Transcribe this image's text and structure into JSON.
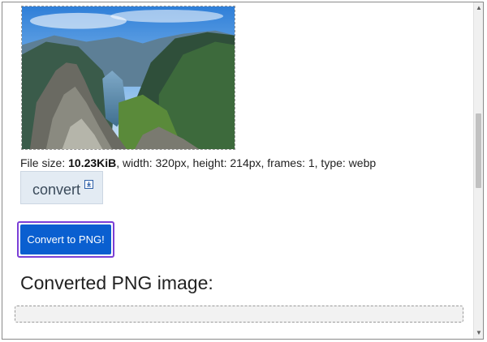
{
  "file_info": {
    "prefix": "File size: ",
    "size": "10.23KiB",
    "suffix": ", width: 320px, height: 214px, frames: 1, type: webp"
  },
  "convert_link": {
    "label": "convert"
  },
  "convert_button": {
    "label": "Convert to PNG!"
  },
  "result": {
    "title": "Converted PNG image:"
  },
  "scrollbar": {
    "up_glyph": "▲",
    "down_glyph": "▼"
  },
  "colors": {
    "button": "#0a5fd0",
    "outline": "#7b3fd6",
    "convert_link_bg": "#e3ebf3"
  },
  "icons": {
    "download": "download-icon"
  }
}
